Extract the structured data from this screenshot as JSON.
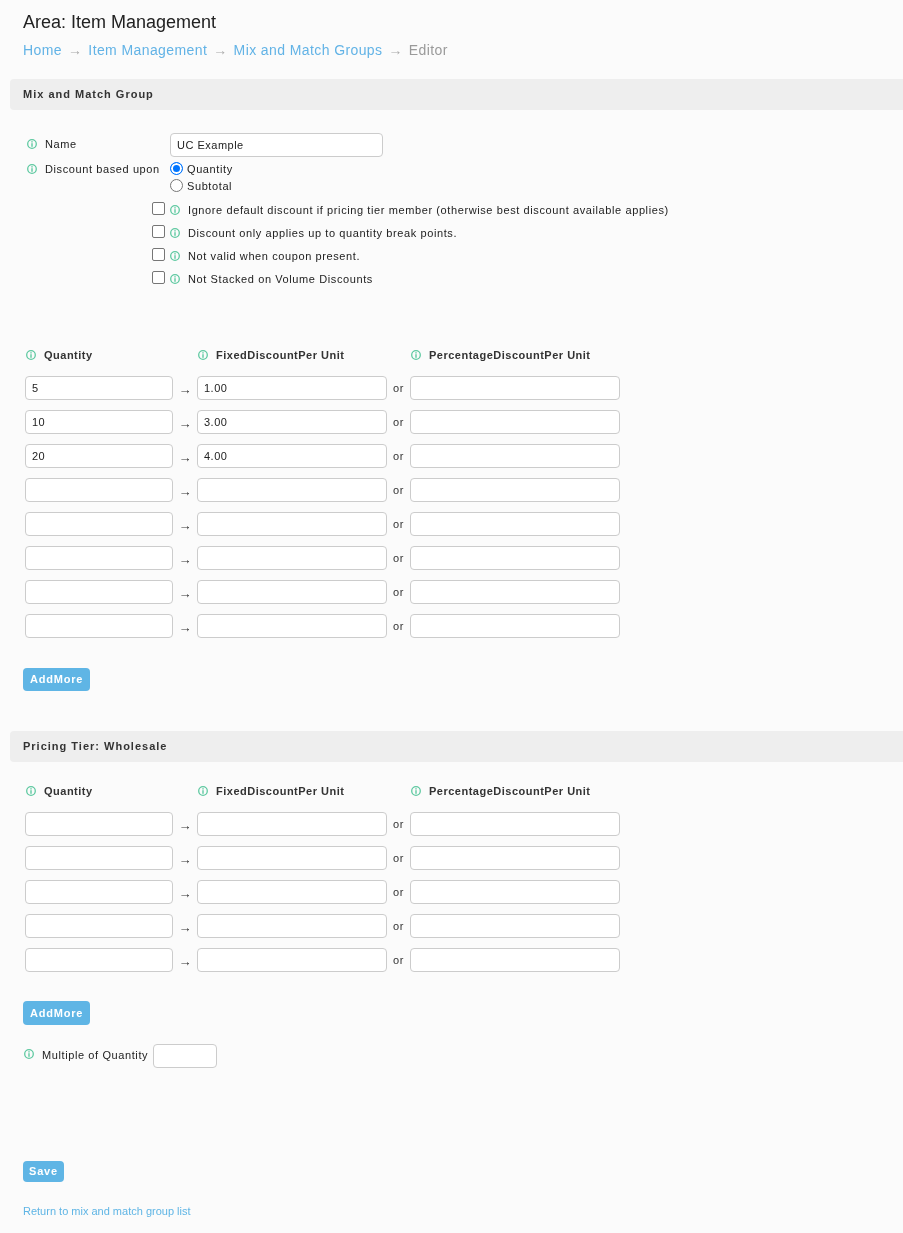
{
  "page_title": "Area: Item Management",
  "breadcrumb": [
    {
      "label": "Home",
      "current": false,
      "separator": "→"
    },
    {
      "label": "Item Management",
      "current": false,
      "separator": "→"
    },
    {
      "label": "Mix and Match Groups",
      "current": false,
      "separator": "→"
    },
    {
      "label": "Editor",
      "current": true
    }
  ],
  "mix_and_match_group": {
    "title": "Mix and Match Group",
    "name": {
      "label": "Name",
      "value": "UC Example"
    },
    "discount_based_upon": {
      "label": "Discount based upon",
      "options": [
        {
          "label": "Quantity",
          "selected": true
        },
        {
          "label": "Subtotal",
          "selected": false
        }
      ]
    },
    "checkboxes": [
      {
        "label": "Ignore default discount if pricing tier member (otherwise best discount available applies)",
        "checked": false
      },
      {
        "label": "Discount only applies up to quantity break points.",
        "checked": false
      },
      {
        "label": "Not valid when coupon present.",
        "checked": false
      },
      {
        "label": "Not Stacked on Volume Discounts",
        "checked": false
      }
    ],
    "tiers": {
      "columns": [
        "Quantity",
        "FixedDiscountPer Unit",
        "PercentageDiscountPer Unit"
      ],
      "rows": [
        {
          "quantity": "5",
          "arrow": "→",
          "fixed_discount": "1.00",
          "or": "or"
        },
        {
          "quantity": "10",
          "arrow": "→",
          "fixed_discount": "3.00",
          "or": "or"
        },
        {
          "quantity": "20",
          "arrow": "→",
          "fixed_discount": "4.00",
          "or": "or"
        },
        {
          "arrow": "→",
          "or": "or"
        },
        {
          "arrow": "→",
          "or": "or"
        },
        {
          "arrow": "→",
          "or": "or"
        },
        {
          "arrow": "→",
          "or": "or"
        },
        {
          "arrow": "→",
          "or": "or"
        }
      ]
    },
    "add_more_button": "AddMore"
  },
  "pricing_tier": {
    "title": "Pricing Tier: Wholesale",
    "tiers": {
      "columns": [
        "Quantity",
        "FixedDiscountPer Unit",
        "PercentageDiscountPer Unit"
      ],
      "rows": [
        {
          "arrow": "→",
          "or": "or"
        },
        {
          "arrow": "→",
          "or": "or"
        },
        {
          "arrow": "→",
          "or": "or"
        },
        {
          "arrow": "→",
          "or": "or"
        },
        {
          "arrow": "→",
          "or": "or"
        }
      ]
    },
    "add_more_button": "AddMore",
    "multiple_of_quantity": {
      "label": "Multiple of Quantity"
    }
  },
  "save_button": "Save",
  "return_link": "Return to mix and match group list"
}
